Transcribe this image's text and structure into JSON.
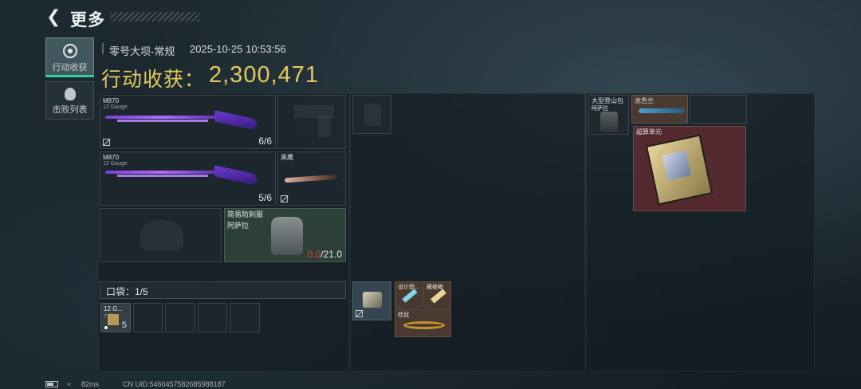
{
  "header": {
    "title": "更多",
    "back_icon": "back-arrow-icon"
  },
  "tabs": [
    {
      "label": "行动收获",
      "icon": "target-icon",
      "active": true
    },
    {
      "label": "击败列表",
      "icon": "skull-icon",
      "active": false
    }
  ],
  "info": {
    "mode": "零号大坝-常规",
    "timestamp": "2025-10-25 10:53:56",
    "harvest_label": "行动收获：",
    "harvest_value": "2,300,471"
  },
  "loadout": {
    "primary1": {
      "name": "M870",
      "sub": "12 Gauge",
      "count": "6/6"
    },
    "primary2": {
      "name": "M870",
      "sub": "12 Gauge",
      "count": "5/6"
    },
    "melee": {
      "name": "黑鹰"
    },
    "armor": {
      "name": "简易防刺服",
      "sub": "阿萨拉",
      "durability_current": "0.0",
      "durability_max": "/21.0"
    },
    "pockets_label": "口袋：1/5",
    "pocket_item": {
      "name": "12 G...",
      "sub": "7 发...",
      "count": "5"
    }
  },
  "middle": {
    "case_items": [
      {
        "name": "设计图..."
      },
      {
        "name": "藏秘箱"
      },
      {
        "name": "桂冠"
      }
    ]
  },
  "right": {
    "backpack": {
      "name": "大型登山包",
      "sub": "阿萨拉"
    },
    "item1": {
      "name": "龙舌兰"
    },
    "item2": {
      "name": "超算单元"
    }
  },
  "footer": {
    "ping": "82ms",
    "uid": "CN UID:5460457582685988187"
  },
  "colors": {
    "accent": "#e7c85c",
    "active_tab": "#2fd0a7",
    "durability_low": "#e0443a",
    "rare_red": "#6a2a2e"
  }
}
